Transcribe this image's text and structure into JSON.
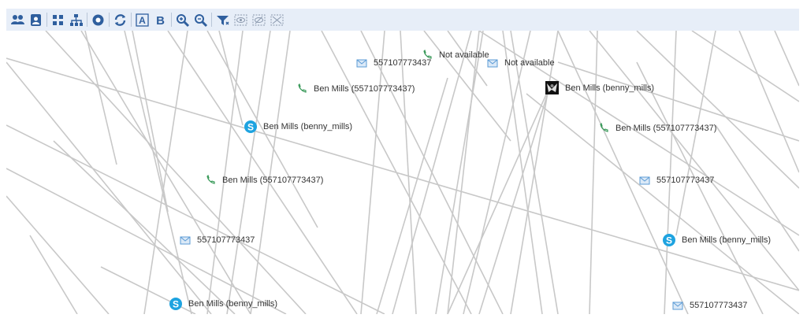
{
  "toolbar": {
    "buttons": [
      {
        "name": "group-icon"
      },
      {
        "name": "contact-card-icon"
      },
      {
        "name": "grid-layout-icon"
      },
      {
        "name": "hierarchy-layout-icon"
      },
      {
        "name": "circle-layout-icon"
      },
      {
        "name": "refresh-layout-icon"
      },
      {
        "name": "text-label-icon"
      },
      {
        "name": "bold-text-icon"
      },
      {
        "name": "zoom-in-icon"
      },
      {
        "name": "zoom-out-icon"
      },
      {
        "name": "filter-icon"
      },
      {
        "name": "show-all-icon"
      },
      {
        "name": "hide-selected-icon"
      },
      {
        "name": "hide-all-icon"
      }
    ],
    "colors": {
      "bar": "#e7eef8",
      "icon": "#2f5f9e"
    }
  },
  "graph": {
    "edge_color": "#c8c8c8",
    "nodes": [
      {
        "type": "sms",
        "label": "557107773437"
      },
      {
        "type": "phone",
        "label": "Not available"
      },
      {
        "type": "sms",
        "label": "Not available"
      },
      {
        "type": "phone",
        "label": "Ben Mills (557107773437)"
      },
      {
        "type": "user",
        "label": "Ben Mills (benny_mills)"
      },
      {
        "type": "skype",
        "label": "Ben Mills (benny_mills)"
      },
      {
        "type": "phone",
        "label": "Ben Mills (557107773437)"
      },
      {
        "type": "phone",
        "label": "Ben Mills (557107773437)"
      },
      {
        "type": "sms",
        "label": "557107773437"
      },
      {
        "type": "sms",
        "label": "557107773437"
      },
      {
        "type": "skype",
        "label": "Ben Mills (benny_mills)"
      },
      {
        "type": "skype",
        "label": "Ben Mills (benny_mills)"
      },
      {
        "type": "sms",
        "label": "557107773437"
      }
    ]
  }
}
